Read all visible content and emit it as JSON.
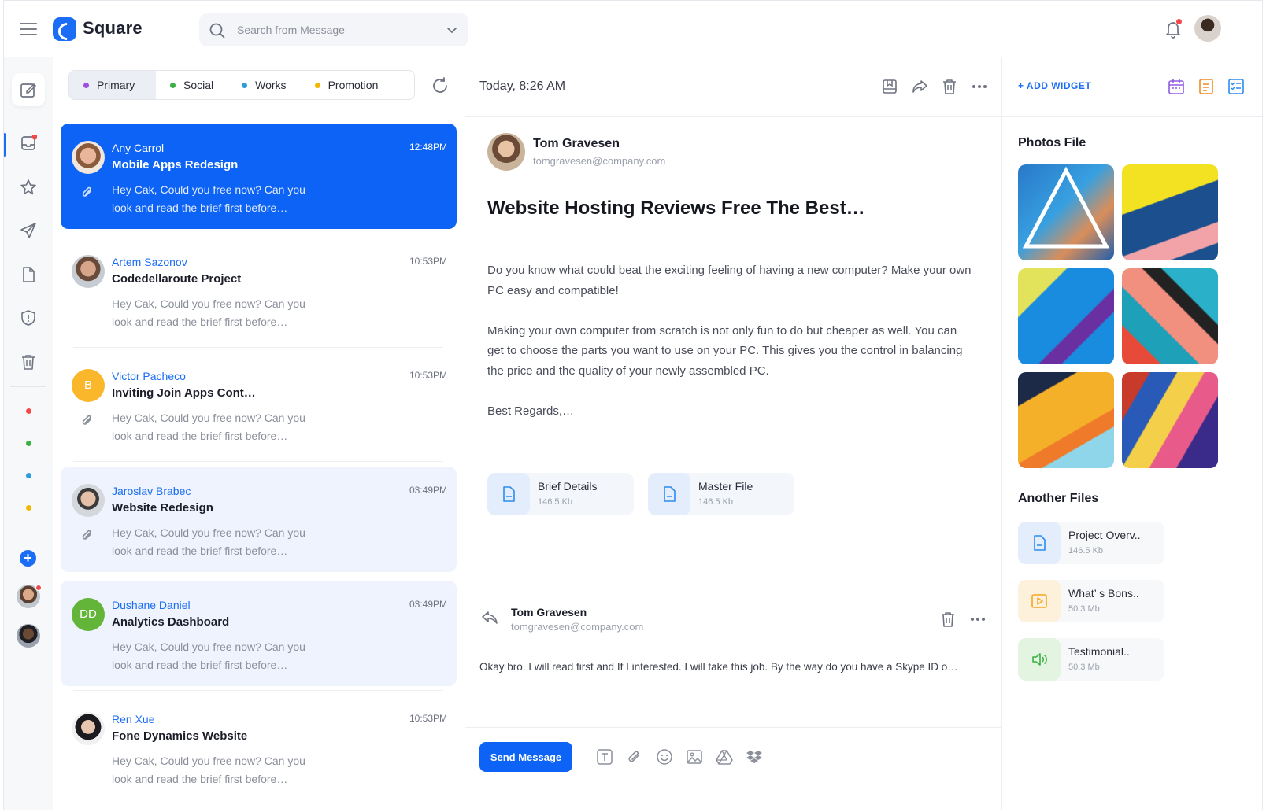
{
  "app": {
    "brand": "Square"
  },
  "search": {
    "placeholder": "Search from Message"
  },
  "tabs": [
    {
      "label": "Primary",
      "color": "#9b51e0"
    },
    {
      "label": "Social",
      "color": "#3cb043"
    },
    {
      "label": "Works",
      "color": "#2d9cdb"
    },
    {
      "label": "Promotion",
      "color": "#f2b705"
    }
  ],
  "messages": [
    {
      "name": "Any Carrol",
      "time": "12:48PM",
      "subject": "Mobile Apps Redesign",
      "preview": "Hey Cak, Could you free now? Can you look and read the brief first before…",
      "attachment": true,
      "state": "selected"
    },
    {
      "name": "Artem Sazonov",
      "time": "10:53PM",
      "subject": "Codedellaroute Project",
      "preview": "Hey Cak, Could you free now? Can you look and read the brief first before…",
      "attachment": false,
      "state": "normal"
    },
    {
      "name": "Victor Pacheco",
      "initial": "B",
      "time": "10:53PM",
      "subject": "Inviting Join Apps Cont…",
      "preview": "Hey Cak, Could you free now? Can you look and read the brief first before…",
      "attachment": true,
      "state": "normal"
    },
    {
      "name": "Jaroslav Brabec",
      "time": "03:49PM",
      "subject": "Website Redesign",
      "preview": "Hey Cak, Could you free now? Can you look and read the brief first before…",
      "attachment": true,
      "state": "highlight"
    },
    {
      "name": "Dushane Daniel",
      "initial": "DD",
      "time": "03:49PM",
      "subject": "Analytics Dashboard",
      "preview": "Hey Cak, Could you free now? Can you look and read the brief first before…",
      "attachment": false,
      "state": "highlight"
    },
    {
      "name": "Ren Xue",
      "time": "10:53PM",
      "subject": "Fone Dynamics Website",
      "preview": "Hey Cak, Could you free now? Can you look and read the brief first before…",
      "attachment": false,
      "state": "normal"
    }
  ],
  "mail": {
    "date": "Today, 8:26 AM",
    "sender_name": "Tom Gravesen",
    "sender_email": "tomgravesen@company.com",
    "title": "Website Hosting Reviews Free The Best…",
    "paragraphs": [
      "Do you know what could beat the exciting feeling of having a new computer? Make your own PC easy and compatible!",
      "Making your own computer from scratch is not only fun to do but cheaper as well. You can get to choose the parts you want to use on your PC. This gives you the control in balancing the price and the quality of your newly assembled PC.",
      "Best Regards,…"
    ],
    "attachments": [
      {
        "name": "Brief Details",
        "size": "146.5 Kb"
      },
      {
        "name": "Master File",
        "size": "146.5 Kb"
      }
    ]
  },
  "reply": {
    "name": "Tom Gravesen",
    "email": "tomgravesen@company.com",
    "text": "Okay bro. I will read first and If I interested. I will take this job. By the way do you have a Skype ID o…",
    "send_label": "Send Message"
  },
  "widgets": {
    "add_label": "+ ADD WIDGET",
    "photos_title": "Photos File",
    "files_title": "Another Files",
    "files": [
      {
        "name": "Project Overv..",
        "size": "146.5 Kb",
        "icon": "document-icon",
        "color": "#2d8cf0"
      },
      {
        "name": "What’ s Bons..",
        "size": "50.3 Mb",
        "icon": "play-icon",
        "color": "#f5a623"
      },
      {
        "name": "Testimonial..",
        "size": "50.3 Mb",
        "icon": "speaker-icon",
        "color": "#3cb043"
      }
    ]
  },
  "colors": {
    "accent": "#0d63f5",
    "notification": "#f24a4a"
  }
}
